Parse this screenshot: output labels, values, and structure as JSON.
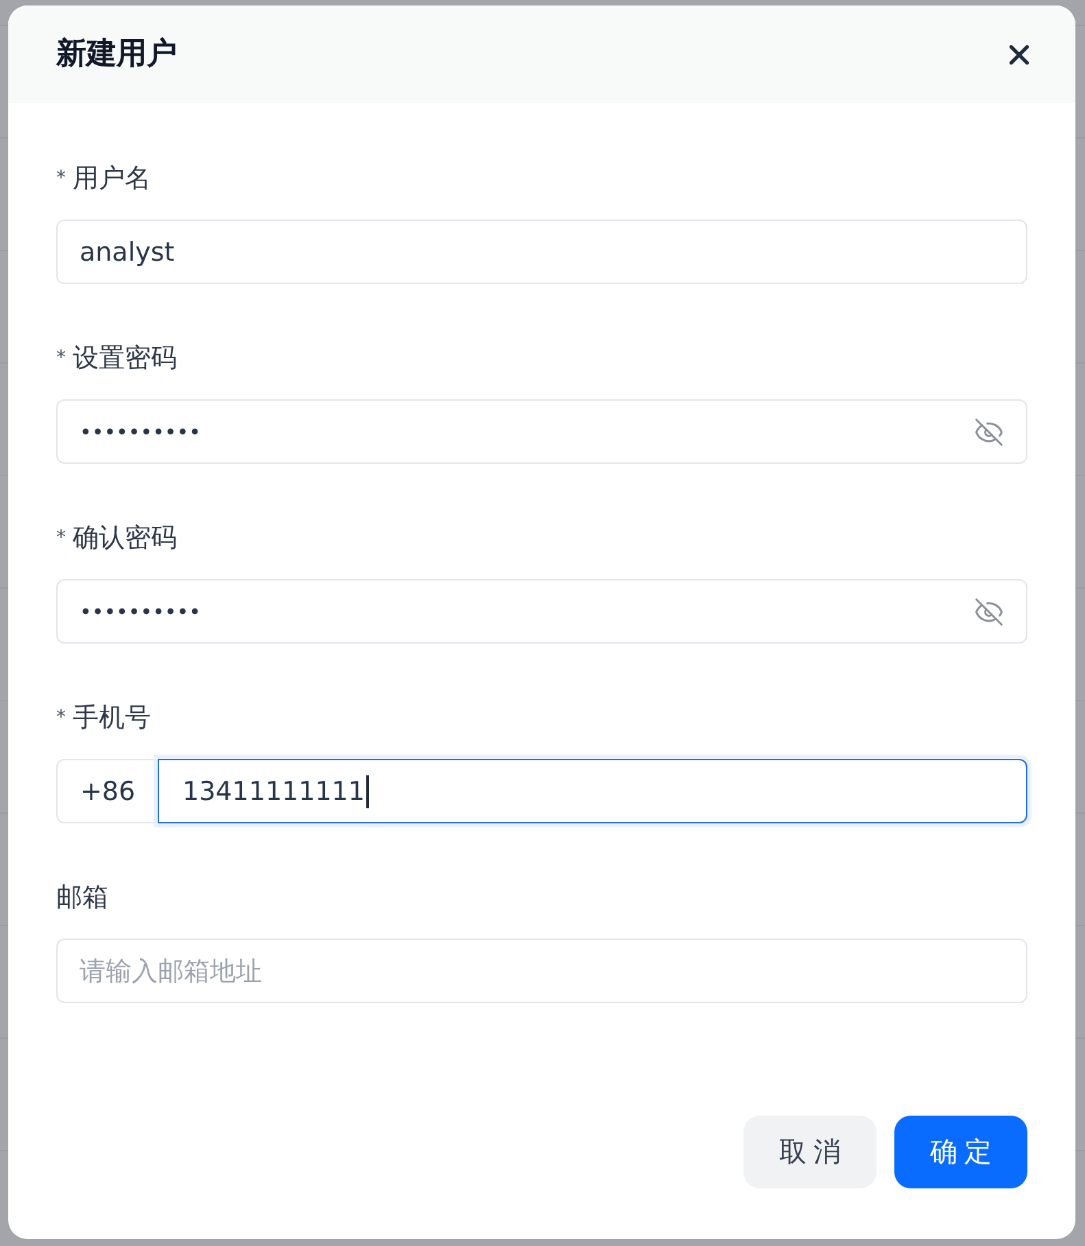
{
  "dialog": {
    "title": "新建用户"
  },
  "fields": [
    {
      "kind": "text",
      "required_mark": "*",
      "label": "用户名",
      "value": "analyst",
      "focused": false
    },
    {
      "kind": "password",
      "required_mark": "*",
      "label": "设置密码",
      "value": "••••••••••",
      "masked": true,
      "focused": false
    },
    {
      "kind": "password",
      "required_mark": "*",
      "label": "确认密码",
      "value": "••••••••••",
      "masked": true,
      "focused": false
    },
    {
      "kind": "phone",
      "required_mark": "*",
      "label": "手机号",
      "prefix": "+86",
      "value": "13411111111",
      "focused": true
    },
    {
      "kind": "text",
      "label": "邮箱",
      "placeholder": "请输入邮箱地址",
      "focused": false
    }
  ],
  "buttons": [
    {
      "kind": "secondary",
      "label": "取消"
    },
    {
      "kind": "primary",
      "label": "确定"
    }
  ]
}
